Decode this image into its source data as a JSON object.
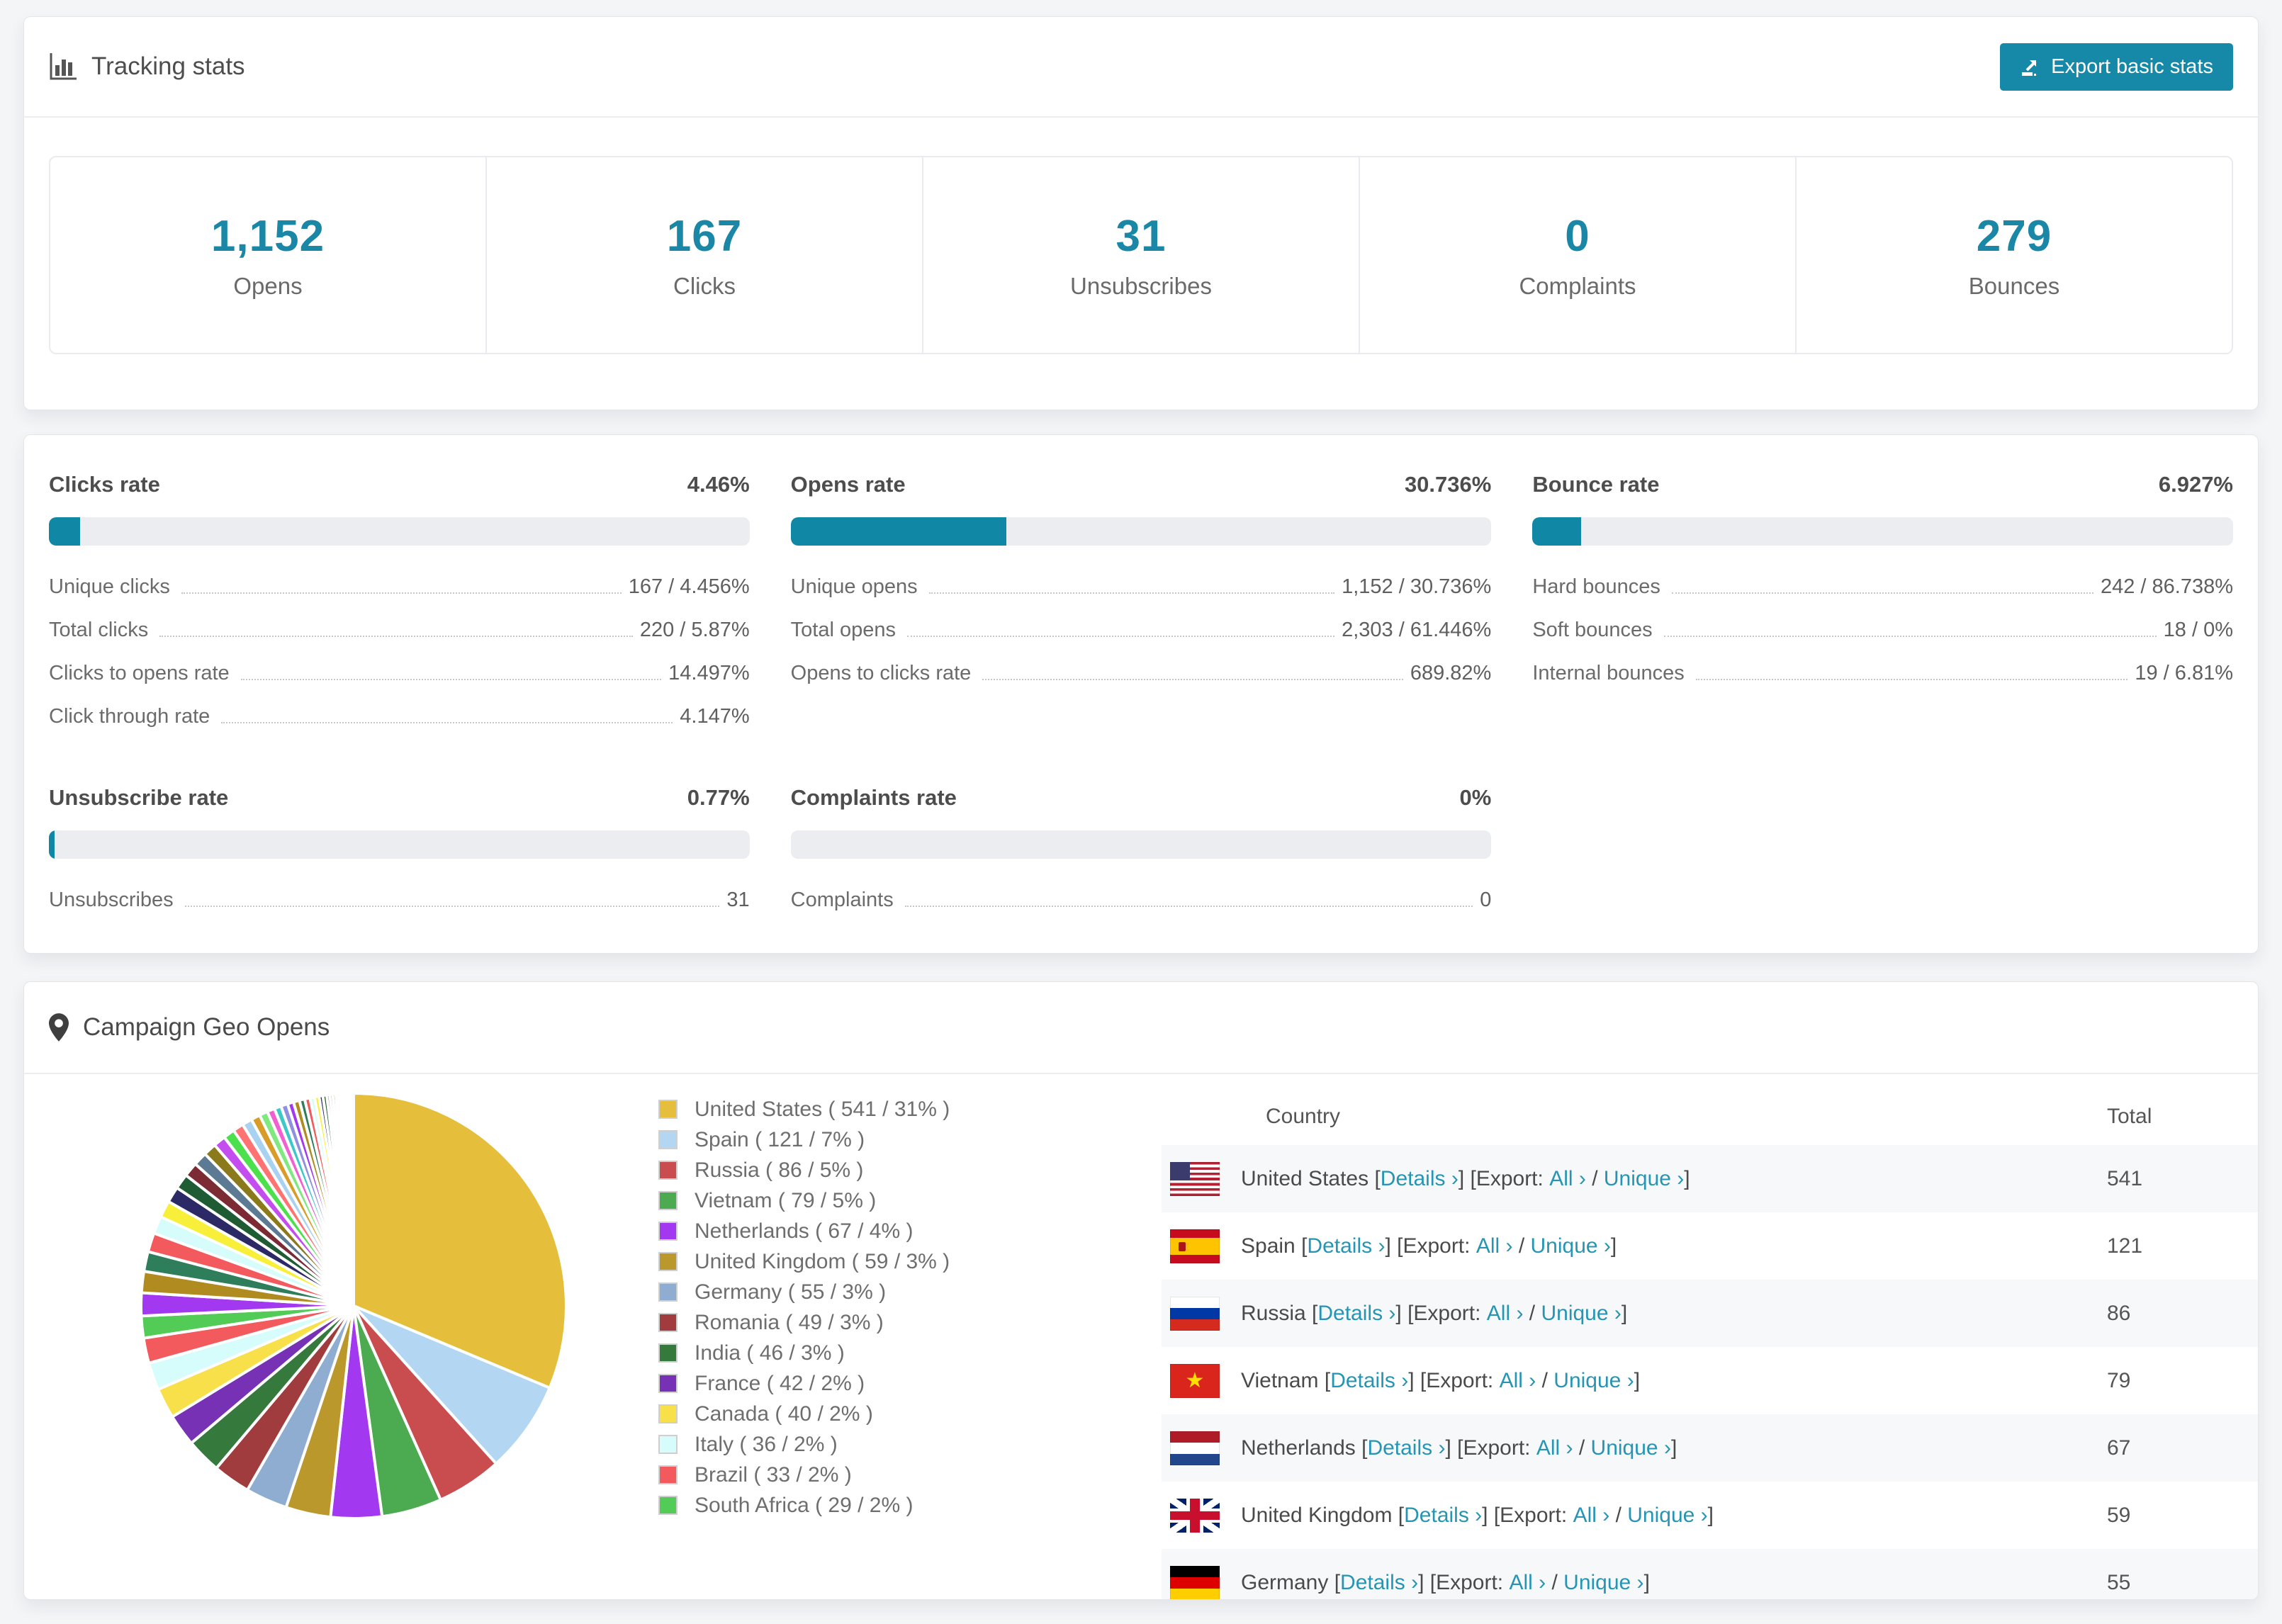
{
  "colors": {
    "accent_teal": "#1789a8",
    "number_teal": "#1987a5",
    "link_teal": "#2695b4",
    "bar_track": "#ebedf0",
    "bar_fill": "#0f87a5",
    "row_stripe": "#f7f8f9"
  },
  "tracking": {
    "title": "Tracking stats",
    "export_button": "Export basic stats",
    "stats": [
      {
        "value": "1,152",
        "label": "Opens"
      },
      {
        "value": "167",
        "label": "Clicks"
      },
      {
        "value": "31",
        "label": "Unsubscribes"
      },
      {
        "value": "0",
        "label": "Complaints"
      },
      {
        "value": "279",
        "label": "Bounces"
      }
    ]
  },
  "rates": {
    "panels": [
      {
        "title": "Clicks rate",
        "value": "4.46%",
        "bar_pct": 4.46,
        "items": [
          {
            "label": "Unique clicks",
            "value": "167 / 4.456%"
          },
          {
            "label": "Total clicks",
            "value": "220 / 5.87%"
          },
          {
            "label": "Clicks to opens rate",
            "value": "14.497%"
          },
          {
            "label": "Click through rate",
            "value": "4.147%"
          }
        ]
      },
      {
        "title": "Opens rate",
        "value": "30.736%",
        "bar_pct": 30.736,
        "items": [
          {
            "label": "Unique opens",
            "value": "1,152 / 30.736%"
          },
          {
            "label": "Total opens",
            "value": "2,303 / 61.446%"
          },
          {
            "label": "Opens to clicks rate",
            "value": "689.82%"
          }
        ]
      },
      {
        "title": "Bounce rate",
        "value": "6.927%",
        "bar_pct": 6.927,
        "items": [
          {
            "label": "Hard bounces",
            "value": "242 / 86.738%"
          },
          {
            "label": "Soft bounces",
            "value": "18 / 0%"
          },
          {
            "label": "Internal bounces",
            "value": "19 / 6.81%"
          }
        ]
      },
      {
        "title": "Unsubscribe rate",
        "value": "0.77%",
        "bar_pct": 0.77,
        "items": [
          {
            "label": "Unsubscribes",
            "value": "31"
          }
        ]
      },
      {
        "title": "Complaints rate",
        "value": "0%",
        "bar_pct": 0,
        "items": [
          {
            "label": "Complaints",
            "value": "0"
          }
        ]
      }
    ]
  },
  "geo": {
    "title": "Campaign Geo Opens",
    "legend": [
      {
        "label": "United States ( 541 / 31% )",
        "color": "#e5bf3c"
      },
      {
        "label": "Spain ( 121 / 7% )",
        "color": "#b3d7f2"
      },
      {
        "label": "Russia ( 86 / 5% )",
        "color": "#c94c4f"
      },
      {
        "label": "Vietnam ( 79 / 5% )",
        "color": "#4caa51"
      },
      {
        "label": "Netherlands ( 67 / 4% )",
        "color": "#a238ef"
      },
      {
        "label": "United Kingdom ( 59 / 3% )",
        "color": "#bb982b"
      },
      {
        "label": "Germany ( 55 / 3% )",
        "color": "#8fadd0"
      },
      {
        "label": "Romania ( 49 / 3% )",
        "color": "#a03b3e"
      },
      {
        "label": "India ( 46 / 3% )",
        "color": "#35793d"
      },
      {
        "label": "France ( 42 / 2% )",
        "color": "#7731b5"
      },
      {
        "label": "Canada ( 40 / 2% )",
        "color": "#f8e04a"
      },
      {
        "label": "Italy ( 36 / 2% )",
        "color": "#d6fcfc"
      },
      {
        "label": "Brazil ( 33 / 2% )",
        "color": "#f25a5d"
      },
      {
        "label": "South Africa ( 29 / 2% )",
        "color": "#53cc57"
      }
    ],
    "table": {
      "headers": {
        "country": "Country",
        "total": "Total"
      },
      "labels": {
        "open": " [",
        "details": "Details ›",
        "mid": "] [Export: ",
        "all": "All ›",
        "slash": " / ",
        "unique": "Unique ›",
        "close": "]"
      },
      "rows": [
        {
          "country": "United States",
          "flag": "us",
          "total": "541"
        },
        {
          "country": "Spain",
          "flag": "es",
          "total": "121"
        },
        {
          "country": "Russia",
          "flag": "ru",
          "total": "86"
        },
        {
          "country": "Vietnam",
          "flag": "vn",
          "total": "79"
        },
        {
          "country": "Netherlands",
          "flag": "nl",
          "total": "67"
        },
        {
          "country": "United Kingdom",
          "flag": "gb",
          "total": "59"
        },
        {
          "country": "Germany",
          "flag": "de",
          "total": "55"
        }
      ]
    }
  },
  "chart_data": {
    "type": "pie",
    "title": "Campaign Geo Opens",
    "legend_position": "right",
    "start_angle": "top",
    "direction": "clockwise",
    "slices": [
      {
        "label": "United States",
        "value": 541,
        "pct": "31%",
        "color": "#e5bf3c"
      },
      {
        "label": "Spain",
        "value": 121,
        "pct": "7%",
        "color": "#b3d7f2"
      },
      {
        "label": "Russia",
        "value": 86,
        "pct": "5%",
        "color": "#c94c4f"
      },
      {
        "label": "Vietnam",
        "value": 79,
        "pct": "5%",
        "color": "#4caa51"
      },
      {
        "label": "Netherlands",
        "value": 67,
        "pct": "4%",
        "color": "#a238ef"
      },
      {
        "label": "United Kingdom",
        "value": 59,
        "pct": "3%",
        "color": "#bb982b"
      },
      {
        "label": "Germany",
        "value": 55,
        "pct": "3%",
        "color": "#8fadd0"
      },
      {
        "label": "Romania",
        "value": 49,
        "pct": "3%",
        "color": "#a03b3e"
      },
      {
        "label": "India",
        "value": 46,
        "pct": "3%",
        "color": "#35793d"
      },
      {
        "label": "France",
        "value": 42,
        "pct": "2%",
        "color": "#7731b5"
      },
      {
        "label": "Canada",
        "value": 40,
        "pct": "2%",
        "color": "#f8e04a"
      },
      {
        "label": "Italy",
        "value": 36,
        "pct": "2%",
        "color": "#d6fcfc"
      },
      {
        "label": "Brazil",
        "value": 33,
        "pct": "2%",
        "color": "#f25a5d"
      },
      {
        "label": "South Africa",
        "value": 29,
        "pct": "2%",
        "color": "#53cc57"
      }
    ],
    "others_values": [
      30,
      28,
      26,
      25,
      23,
      22,
      21,
      20,
      19,
      18,
      17,
      16,
      15,
      14,
      13,
      12,
      11,
      10,
      9,
      9,
      8,
      8,
      7,
      7,
      6,
      6,
      5,
      5,
      4,
      4,
      4,
      3,
      3,
      3,
      2,
      2,
      2,
      2,
      1,
      1,
      1,
      1,
      1,
      1
    ],
    "others_palette": [
      "#a238ef",
      "#b08c20",
      "#2e7d5b",
      "#f25a5d",
      "#d6fcfc",
      "#f8ef3a",
      "#2b2a66",
      "#1f5c33",
      "#7c2a33",
      "#5c7a93",
      "#8a7a1c",
      "#c44df0",
      "#4ce04c",
      "#ff7373",
      "#a8d2f0",
      "#d89c28",
      "#7fe87f",
      "#f060d0",
      "#3cc8c8",
      "#9090e0"
    ]
  }
}
